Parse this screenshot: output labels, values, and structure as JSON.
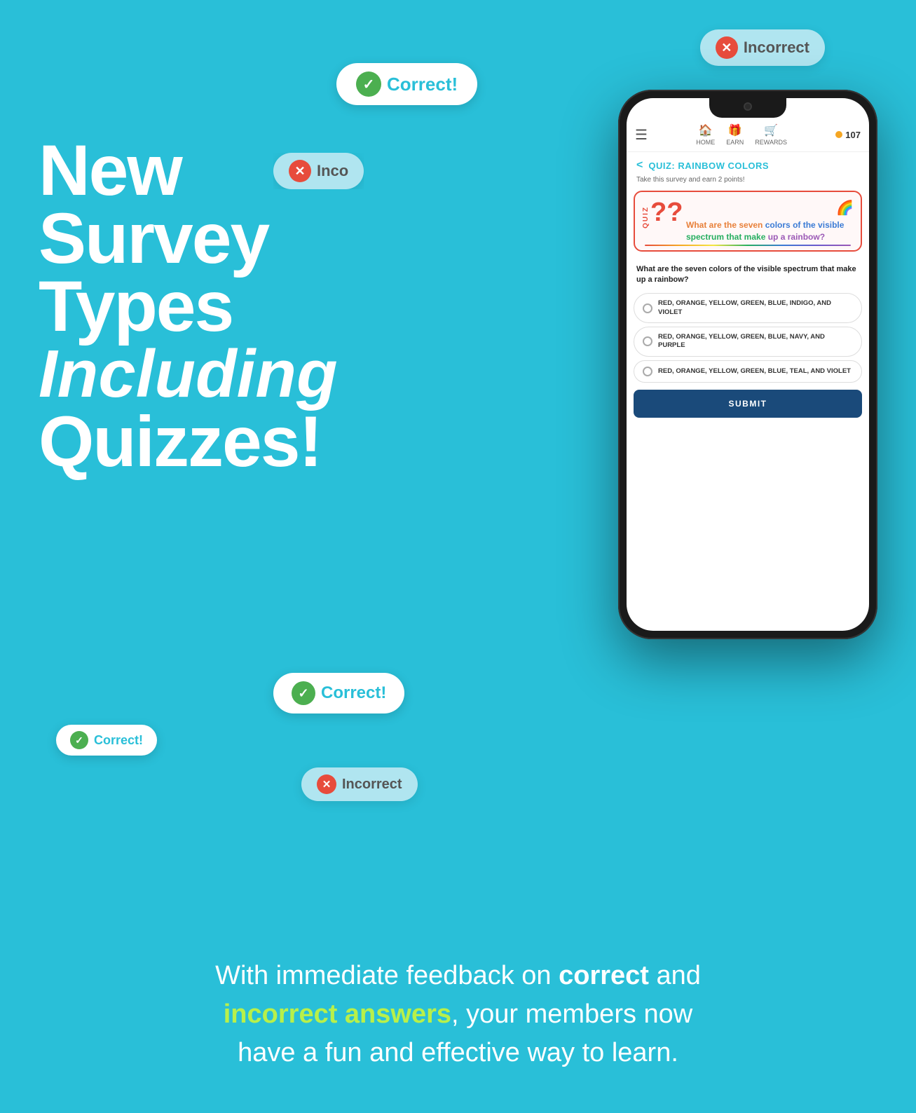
{
  "background_color": "#29bfd8",
  "badges": {
    "top_right": {
      "type": "incorrect",
      "label": "Incorrect"
    },
    "top_center": {
      "type": "correct",
      "label": "Correct!"
    },
    "mid_left": {
      "type": "incorrect",
      "label": "Inco..."
    },
    "bottom_large": {
      "type": "correct",
      "label": "Correct!"
    },
    "bottom_left": {
      "type": "correct",
      "label": "Correct!"
    },
    "bottom_center": {
      "type": "incorrect",
      "label": "Incorrect"
    }
  },
  "hero": {
    "line1": "New",
    "line2": "Survey",
    "line3": "Types",
    "line4": "Including",
    "line5": "Quizzes!"
  },
  "phone": {
    "nav": {
      "home_label": "HOME",
      "earn_label": "EARN",
      "rewards_label": "REWARDS",
      "points": "107"
    },
    "quiz": {
      "back_label": "<",
      "title": "QUIZ: RAINBOW COLORS",
      "subtitle": "Take this survey and earn 2 points!",
      "card_label": "QUIZ",
      "question_marks": "??",
      "rainbow_emoji": "🌈",
      "card_question_line1": "What are the seven",
      "card_question_line2": "colors of the visible",
      "card_question_line3": "spectrum that make",
      "card_question_line4": "up a rainbow?",
      "main_question": "What are the seven colors of the visible spectrum that make up a rainbow?",
      "options": [
        "RED, ORANGE, YELLOW, GREEN, BLUE, INDIGO, AND VIOLET",
        "RED, ORANGE, YELLOW, GREEN, BLUE, NAVY, AND PURPLE",
        "RED, ORANGE, YELLOW, GREEN, BLUE, TEAL, AND VIOLET"
      ],
      "submit_label": "SUBMIT"
    }
  },
  "bottom_text": {
    "part1": "With immediate feedback on ",
    "bold1": "correct",
    "part2": " and",
    "line2_start": "",
    "green1": "incorrect answers",
    "part3": ", your members now",
    "line3": "have a fun and effective way to learn."
  }
}
